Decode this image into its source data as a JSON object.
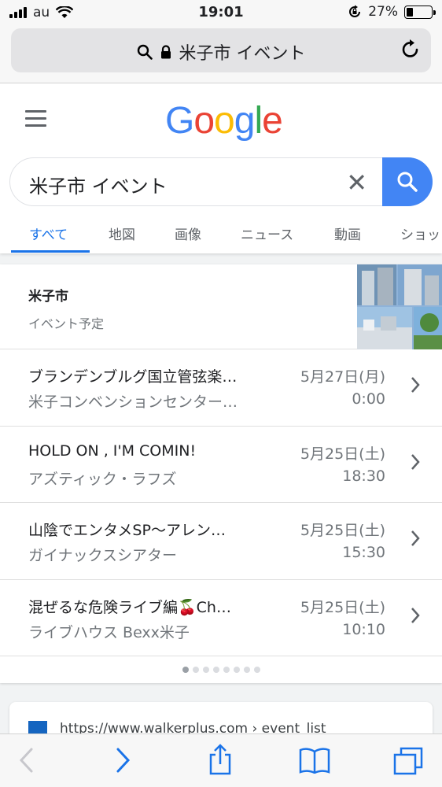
{
  "status_bar": {
    "carrier": "au",
    "time": "19:01",
    "battery": "27%",
    "battery_level": 0.27
  },
  "url_bar": {
    "text": "米子市 イベント"
  },
  "google": {
    "logo": [
      "G",
      "o",
      "o",
      "g",
      "l",
      "e"
    ],
    "logo_colors": [
      "#4285f4",
      "#ea4335",
      "#fbbc05",
      "#4285f4",
      "#34a853",
      "#ea4335"
    ],
    "query": "米子市 イベント",
    "tabs": [
      "すべて",
      "地図",
      "画像",
      "ニュース",
      "動画",
      "ショッ"
    ]
  },
  "events_card": {
    "title": "米子市",
    "subtitle": "イベント予定",
    "events": [
      {
        "name": "ブランデンブルグ国立管弦楽…",
        "venue": "米子コンベンションセンター…",
        "date": "5月27日(月)",
        "time": "0:00"
      },
      {
        "name": "HOLD ON , I'M COMIN!",
        "venue": "アズティック・ラフズ",
        "date": "5月25日(土)",
        "time": "18:30"
      },
      {
        "name": "山陰でエンタメSP〜アレン…",
        "venue": "ガイナックスシアター",
        "date": "5月25日(土)",
        "time": "15:30"
      },
      {
        "name": "混ぜるな危険ライブ編🍒Ch…",
        "venue": "ライブハウス Bexx米子",
        "date": "5月25日(土)",
        "time": "10:10"
      }
    ],
    "page_index": 1,
    "page_count": 8
  },
  "next_result": {
    "url": "https://www.walkerplus.com › event_list"
  },
  "colors": {
    "accent": "#1a73e8",
    "search_button": "#4285f4"
  }
}
